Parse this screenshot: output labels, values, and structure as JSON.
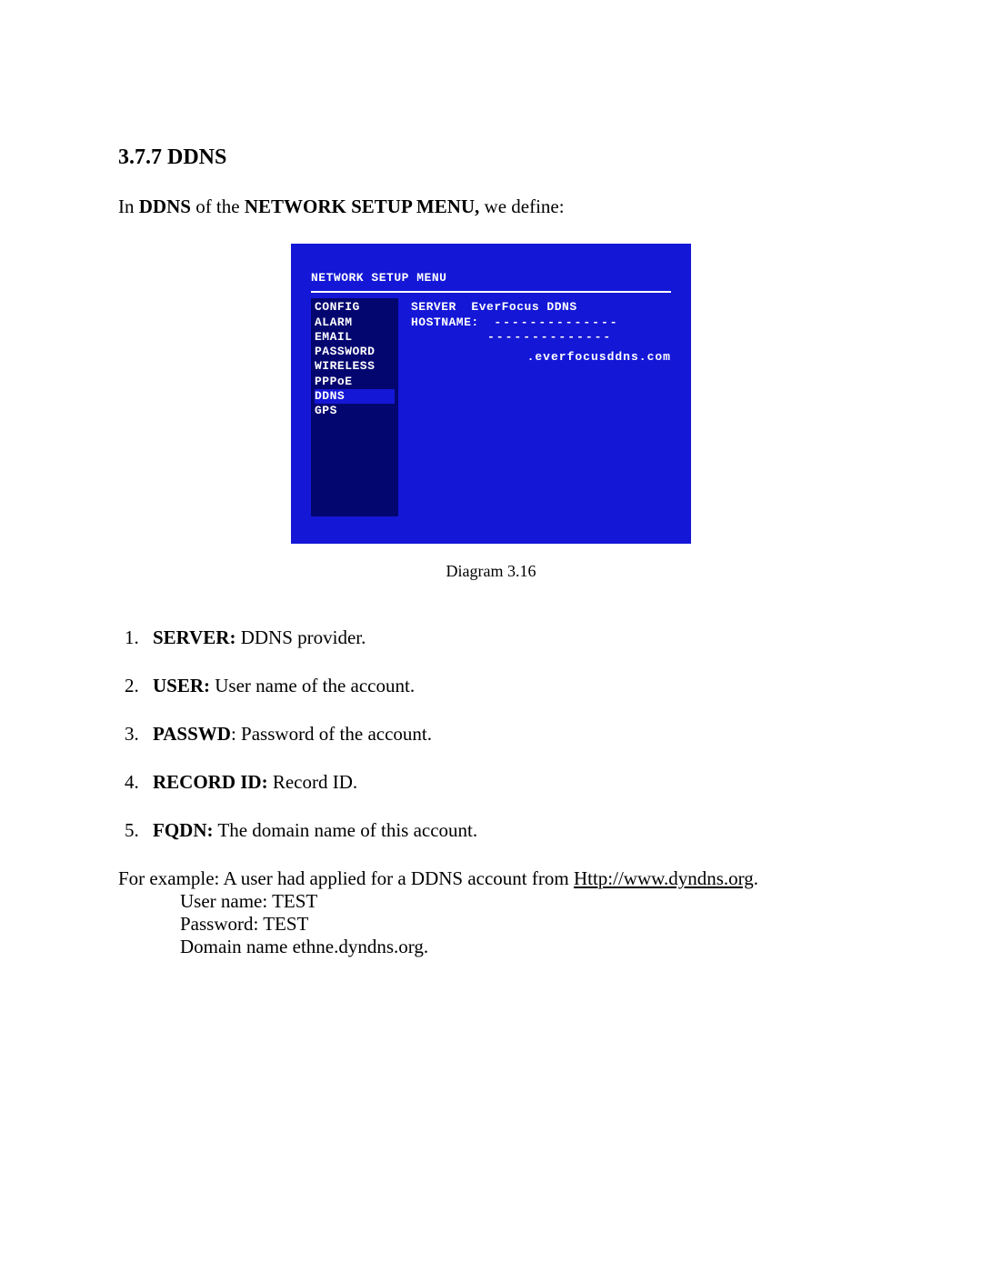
{
  "heading": "3.7.7 DDNS",
  "intro": {
    "pre": "In ",
    "b1": "DDNS",
    "mid": " of the ",
    "b2": "NETWORK SETUP MENU,",
    "post": " we define:"
  },
  "terminal": {
    "title": "NETWORK SETUP MENU",
    "sidebar": {
      "config": "CONFIG",
      "alarm": "ALARM",
      "email": "EMAIL",
      "password": "PASSWORD",
      "wireless": "WIRELESS",
      "pppoe": "PPPoE",
      "ddns": "DDNS",
      "gps": "GPS"
    },
    "server_label": "SERVER",
    "server_value": "EverFocus DDNS",
    "hostname_label": "HOSTNAME:",
    "hostname_value": "--------------",
    "hostname_value2": "--------------",
    "domain_suffix": ".everfocusddns.com"
  },
  "caption": "Diagram 3.16",
  "defs": {
    "d1": {
      "term": "SERVER:",
      "desc": " DDNS provider."
    },
    "d2": {
      "term": "USER:",
      "desc": " User name of the account."
    },
    "d3": {
      "term": "PASSWD",
      "desc": ": Password of the account."
    },
    "d4": {
      "term": "RECORD ID:",
      "desc": " Record ID."
    },
    "d5": {
      "term": "FQDN:",
      "desc": " The domain name of this account."
    }
  },
  "example": {
    "line1_pre": "For example: A user had applied for a DDNS account from ",
    "line1_link": "Http://www.dyndns.org",
    "line1_post": ".",
    "line2": "User name: TEST",
    "line3": "Password: TEST",
    "line4": "Domain name ethne.dyndns.org."
  }
}
